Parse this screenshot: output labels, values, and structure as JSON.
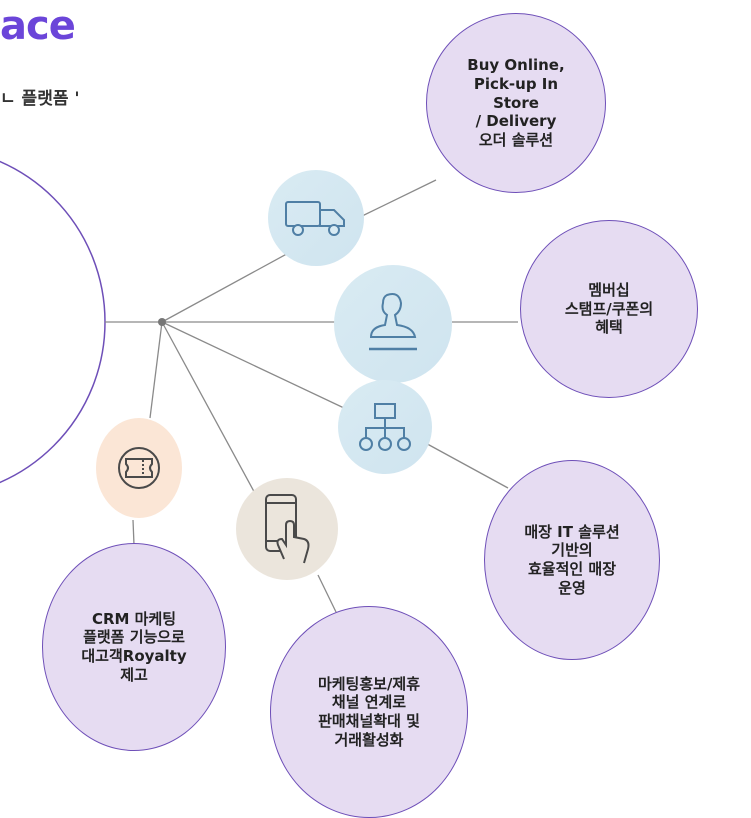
{
  "header": {
    "brand": "ace",
    "subtitle": "ㄴ 플랫폼 '"
  },
  "bubbles": {
    "delivery": "Buy Online,\nPick-up In\nStore\n/ Delivery\n오더 솔루션",
    "membership": "멤버십\n스탬프/쿠폰의\n혜택",
    "store_it": "매장 IT 솔루션\n기반의\n효율적인 매장\n운영",
    "marketing": "마케팅홍보/제휴\n채널 연계로\n판매채널확대 및\n거래활성화",
    "crm": "CRM 마케팅\n플랫폼 기능으로\n대고객Royalty\n제고"
  },
  "icons": {
    "delivery": "truck-icon",
    "membership": "stamp-icon",
    "store_it": "org-chart-icon",
    "marketing": "smartphone-touch-icon",
    "crm": "coupon-ticket-icon"
  },
  "colors": {
    "brand": "#6b45d9",
    "bubble_fill": "#e6dcf2",
    "bubble_border": "#6e4fb8",
    "icon_blue": "#d9ebf3",
    "icon_peach": "#fbe6d6",
    "icon_beige": "#ebe5dc",
    "line_blue": "#5b86a8",
    "line_orange": "#c78550",
    "line_gray": "#7e7a74"
  }
}
